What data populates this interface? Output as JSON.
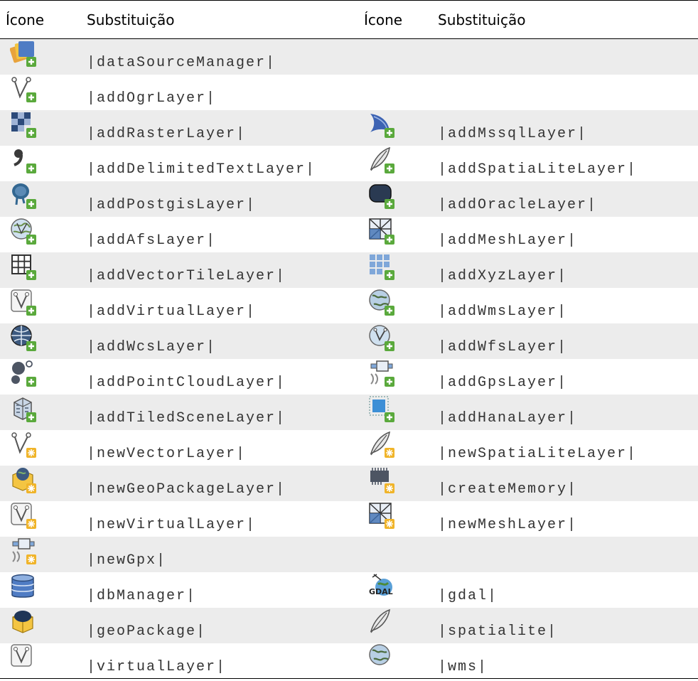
{
  "header": {
    "col1": "Ícone",
    "col2": "Substituição",
    "col3": "Ícone",
    "col4": "Substituição"
  },
  "rows": [
    {
      "left_icon": "data-source-manager-icon",
      "left": "|dataSourceManager|",
      "right_icon": "",
      "right": ""
    },
    {
      "left_icon": "add-ogr-layer-icon",
      "left": "|addOgrLayer|",
      "right_icon": "",
      "right": ""
    },
    {
      "left_icon": "add-raster-layer-icon",
      "left": "|addRasterLayer|",
      "right_icon": "add-mssql-layer-icon",
      "right": "|addMssqlLayer|"
    },
    {
      "left_icon": "add-delimited-text-layer-icon",
      "left": "|addDelimitedTextLayer|",
      "right_icon": "add-spatialite-layer-icon",
      "right": "|addSpatiaLiteLayer|"
    },
    {
      "left_icon": "add-postgis-layer-icon",
      "left": "|addPostgisLayer|",
      "right_icon": "add-oracle-layer-icon",
      "right": "|addOracleLayer|"
    },
    {
      "left_icon": "add-afs-layer-icon",
      "left": "|addAfsLayer|",
      "right_icon": "add-mesh-layer-icon",
      "right": "|addMeshLayer|"
    },
    {
      "left_icon": "add-vector-tile-layer-icon",
      "left": "|addVectorTileLayer|",
      "right_icon": "add-xyz-layer-icon",
      "right": "|addXyzLayer|"
    },
    {
      "left_icon": "add-virtual-layer-icon",
      "left": "|addVirtualLayer|",
      "right_icon": "add-wms-layer-icon",
      "right": "|addWmsLayer|"
    },
    {
      "left_icon": "add-wcs-layer-icon",
      "left": "|addWcsLayer|",
      "right_icon": "add-wfs-layer-icon",
      "right": "|addWfsLayer|"
    },
    {
      "left_icon": "add-point-cloud-layer-icon",
      "left": "|addPointCloudLayer|",
      "right_icon": "add-gps-layer-icon",
      "right": "|addGpsLayer|"
    },
    {
      "left_icon": "add-tiled-scene-layer-icon",
      "left": "|addTiledSceneLayer|",
      "right_icon": "add-hana-layer-icon",
      "right": "|addHanaLayer|"
    },
    {
      "left_icon": "new-vector-layer-icon",
      "left": "|newVectorLayer|",
      "right_icon": "new-spatialite-layer-icon",
      "right": "|newSpatiaLiteLayer|"
    },
    {
      "left_icon": "new-geopackage-layer-icon",
      "left": "|newGeoPackageLayer|",
      "right_icon": "create-memory-icon",
      "right": "|createMemory|"
    },
    {
      "left_icon": "new-virtual-layer-icon",
      "left": "|newVirtualLayer|",
      "right_icon": "new-mesh-layer-icon",
      "right": "|newMeshLayer|"
    },
    {
      "left_icon": "new-gpx-icon",
      "left": "|newGpx|",
      "right_icon": "",
      "right": ""
    },
    {
      "left_icon": "db-manager-icon",
      "left": "|dbManager|",
      "right_icon": "gdal-icon",
      "right": "|gdal|"
    },
    {
      "left_icon": "geopackage-icon",
      "left": "|geoPackage|",
      "right_icon": "spatialite-icon",
      "right": "|spatialite|"
    },
    {
      "left_icon": "virtual-layer-icon",
      "left": "|virtualLayer|",
      "right_icon": "wms-icon",
      "right": "|wms|"
    }
  ],
  "gdal_logo_text": "GDAL"
}
